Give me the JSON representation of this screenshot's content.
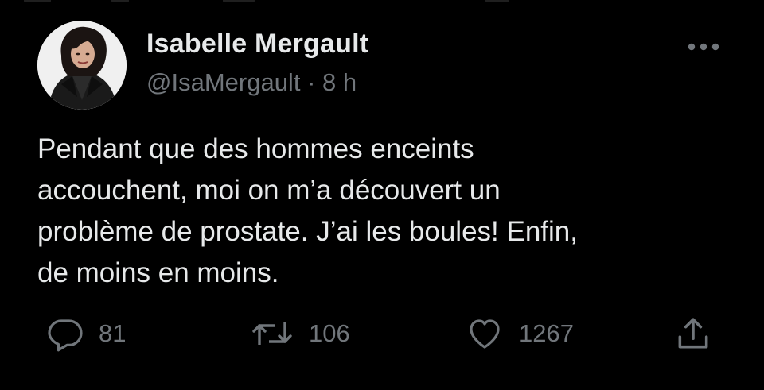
{
  "tweet": {
    "author": {
      "display_name": "Isabelle Mergault",
      "handle": "@IsaMergault",
      "avatar_icon": "profile-photo"
    },
    "separator": "·",
    "time_ago": "8 h",
    "text_lines": [
      "Pendant que des hommes enceints",
      "accouchent, moi on m’a découvert un",
      "problème de prostate. J’ai les boules! Enfin,",
      "de moins en moins."
    ],
    "actions": {
      "reply": {
        "icon": "reply-icon",
        "count": "81"
      },
      "retweet": {
        "icon": "retweet-icon",
        "count": "106"
      },
      "like": {
        "icon": "heart-icon",
        "count": "1267"
      },
      "share": {
        "icon": "share-icon"
      }
    },
    "more_icon": "more-dots-icon"
  },
  "colors": {
    "background": "#000000",
    "primary_text": "#e7e9ea",
    "secondary_text": "#71767b"
  }
}
